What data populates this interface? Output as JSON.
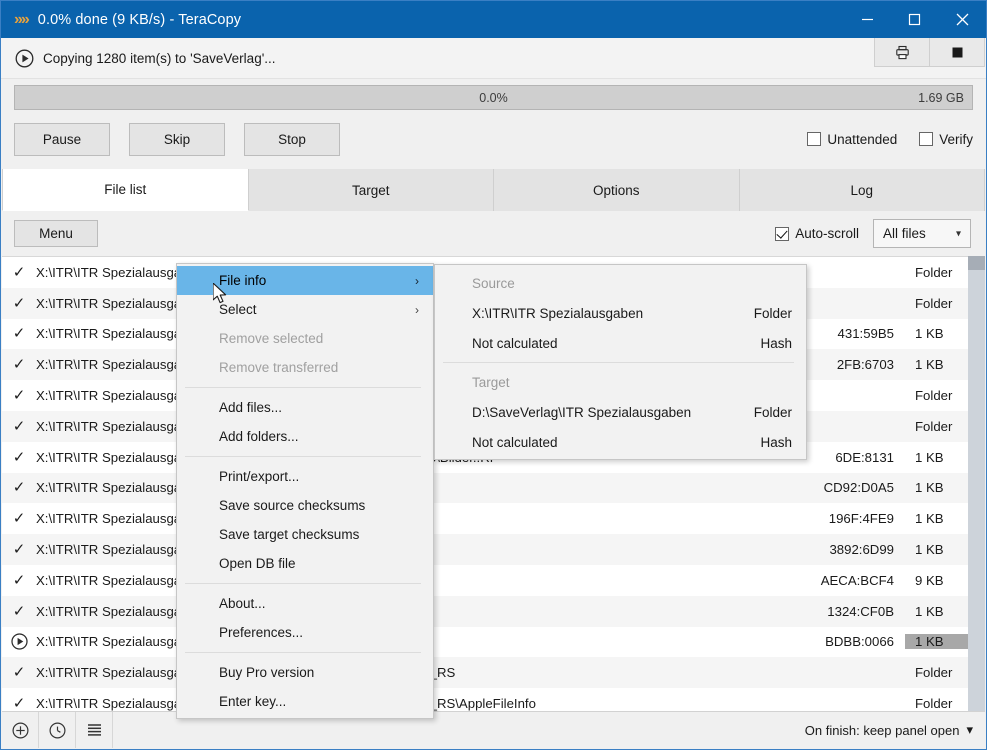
{
  "window": {
    "title": "0.0% done (9 KB/s) - TeraCopy",
    "logo": "chevrons-icon",
    "minimize": "minimize-icon",
    "maximize": "maximize-icon",
    "close": "close-icon"
  },
  "header": {
    "status_text": "Copying 1280 item(s) to 'SaveVerlag'...",
    "play_icon": "play-circle-icon",
    "tool_print": "print-icon",
    "tool_stop": "stop-square-icon"
  },
  "progress": {
    "percent_label": "0.0%",
    "percent_value": 0,
    "size_label": "1.69 GB"
  },
  "actions": {
    "pause": "Pause",
    "skip": "Skip",
    "stop": "Stop",
    "unattended_label": "Unattended",
    "unattended_checked": false,
    "verify_label": "Verify",
    "verify_checked": false
  },
  "tabs": [
    {
      "label": "File list",
      "active": true
    },
    {
      "label": "Target",
      "active": false
    },
    {
      "label": "Options",
      "active": false
    },
    {
      "label": "Log",
      "active": false
    }
  ],
  "toolbar": {
    "menu_label": "Menu",
    "autoscroll_label": "Auto-scroll",
    "autoscroll_checked": true,
    "filter_value": "All files",
    "filter_caret": "chevron-down-icon"
  },
  "filelist": {
    "columns": [
      "status",
      "path",
      "hash",
      "size"
    ],
    "rows": [
      {
        "status": "done",
        "path": "X:\\ITR\\ITR Spezialausgaben",
        "hash": "",
        "size": "Folder",
        "size_highlight": false
      },
      {
        "status": "done",
        "path": "X:\\ITR\\ITR Spezialausgaben\\Archiv",
        "hash": "",
        "size": "Folder",
        "size_highlight": false
      },
      {
        "status": "done",
        "path": "X:\\ITR\\ITR Spezialausgaben\\Archiv\\Bildeli-ITR..RF",
        "hash": "431:59B5",
        "size": "1 KB",
        "size_highlight": false
      },
      {
        "status": "done",
        "path": "X:\\ITR\\ITR Spezialausgaben\\Archiv\\Bilder..RF",
        "hash": "2FB:6703",
        "size": "1 KB",
        "size_highlight": false
      },
      {
        "status": "done",
        "path": "X:\\ITR\\ITR Spezialausgaben\\Archiv\\ITR_Special_1_01",
        "hash": "",
        "size": "Folder",
        "size_highlight": false
      },
      {
        "status": "done",
        "path": "X:\\ITR\\ITR Spezialausgaben\\Archiv\\ITR_Special_1_01\\0-ITR",
        "hash": "",
        "size": "Folder",
        "size_highlight": false
      },
      {
        "status": "done",
        "path": "X:\\ITR\\ITR Spezialausgaben\\Archiv\\ITR_Special_1_01\\AppleFileInfo\\Bilder..RF",
        "hash": "6DE:8131",
        "size": "1 KB",
        "size_highlight": false
      },
      {
        "status": "done",
        "path": "X:\\ITR\\ITR Spezialausgaben\\Archiv\\AppleFileInfo\\Bildeli-ITR..RF",
        "hash": "CD92:D0A5",
        "size": "1 KB",
        "size_highlight": false
      },
      {
        "status": "done",
        "path": "X:\\ITR\\ITR Spezialausgaben\\Archiv\\AppleFileInfo\\Bilder..RF",
        "hash": "196F:4FE9",
        "size": "1 KB",
        "size_highlight": false
      },
      {
        "status": "done",
        "path": "X:\\ITR\\ITR Spezialausgaben\\Archiv\\AppleFileInfo\\Bildeli-ITR..RF",
        "hash": "3892:6D99",
        "size": "1 KB",
        "size_highlight": false
      },
      {
        "status": "done",
        "path": "X:\\ITR\\ITR Spezialausgaben\\Archiv\\AppleFileInfo\\Bilder..RF",
        "hash": "AECA:BCF4",
        "size": "9 KB",
        "size_highlight": false
      },
      {
        "status": "done",
        "path": "X:\\ITR\\ITR Spezialausgaben\\Archiv\\AppleFileInfo\\Bildeli-ITR..RF",
        "hash": "1324:CF0B",
        "size": "1 KB",
        "size_highlight": false
      },
      {
        "status": "active",
        "path": "X:\\ITR\\ITR Spezialausgaben\\Archiv\\AppleFileInfo\\Spezial_01..RF",
        "hash": "BDBB:0066",
        "size": "1 KB",
        "size_highlight": true
      },
      {
        "status": "done",
        "path": "X:\\ITR\\ITR Spezialausgaben\\Archiv\\ITR_Special_1_02\\0-ITR_Spez_RS",
        "hash": "",
        "size": "Folder",
        "size_highlight": false
      },
      {
        "status": "done",
        "path": "X:\\ITR\\ITR Spezialausgaben\\Archiv\\ITR_Special_1_02\\0-ITR_Spez_RS\\AppleFileInfo",
        "hash": "",
        "size": "Folder",
        "size_highlight": false
      }
    ]
  },
  "context_menu": {
    "items": [
      {
        "label": "File info",
        "state": "highlighted",
        "submenu": true
      },
      {
        "label": "Select",
        "state": "normal",
        "submenu": true
      },
      {
        "label": "Remove selected",
        "state": "disabled",
        "submenu": false
      },
      {
        "label": "Remove transferred",
        "state": "disabled",
        "submenu": false
      },
      {
        "separator": true
      },
      {
        "label": "Add files...",
        "state": "normal",
        "submenu": false
      },
      {
        "label": "Add folders...",
        "state": "normal",
        "submenu": false
      },
      {
        "separator": true
      },
      {
        "label": "Print/export...",
        "state": "normal",
        "submenu": false
      },
      {
        "label": "Save source checksums",
        "state": "normal",
        "submenu": false
      },
      {
        "label": "Save target checksums",
        "state": "normal",
        "submenu": false
      },
      {
        "label": "Open DB file",
        "state": "normal",
        "submenu": false
      },
      {
        "separator": true
      },
      {
        "label": "About...",
        "state": "normal",
        "submenu": false
      },
      {
        "label": "Preferences...",
        "state": "normal",
        "submenu": false
      },
      {
        "separator": true
      },
      {
        "label": "Buy Pro version",
        "state": "normal",
        "submenu": false
      },
      {
        "label": "Enter key...",
        "state": "normal",
        "submenu": false
      }
    ]
  },
  "file_info_submenu": {
    "source_header": "Source",
    "source_path": "X:\\ITR\\ITR Spezialausgaben",
    "source_path_type": "Folder",
    "source_hash": "Not calculated",
    "source_hash_label": "Hash",
    "target_header": "Target",
    "target_path": "D:\\SaveVerlag\\ITR Spezialausgaben",
    "target_path_type": "Folder",
    "target_hash": "Not calculated",
    "target_hash_label": "Hash"
  },
  "statusbar": {
    "icon_add": "plus-circle-icon",
    "icon_history": "clock-icon",
    "icon_list": "list-lines-icon",
    "on_finish": "On finish: keep panel open",
    "on_finish_caret": "chevron-down-icon"
  },
  "colors": {
    "titlebar": "#0a63ad",
    "logo": "#e8a33d",
    "menu_highlight": "#69b5e8",
    "row_alt": "#f5f5f5",
    "size_highlight": "#a8a8a8",
    "scrollbar_track": "#cdd3da",
    "scrollbar_thumb": "#a6adb6",
    "window_border": "#3a7fc4"
  }
}
